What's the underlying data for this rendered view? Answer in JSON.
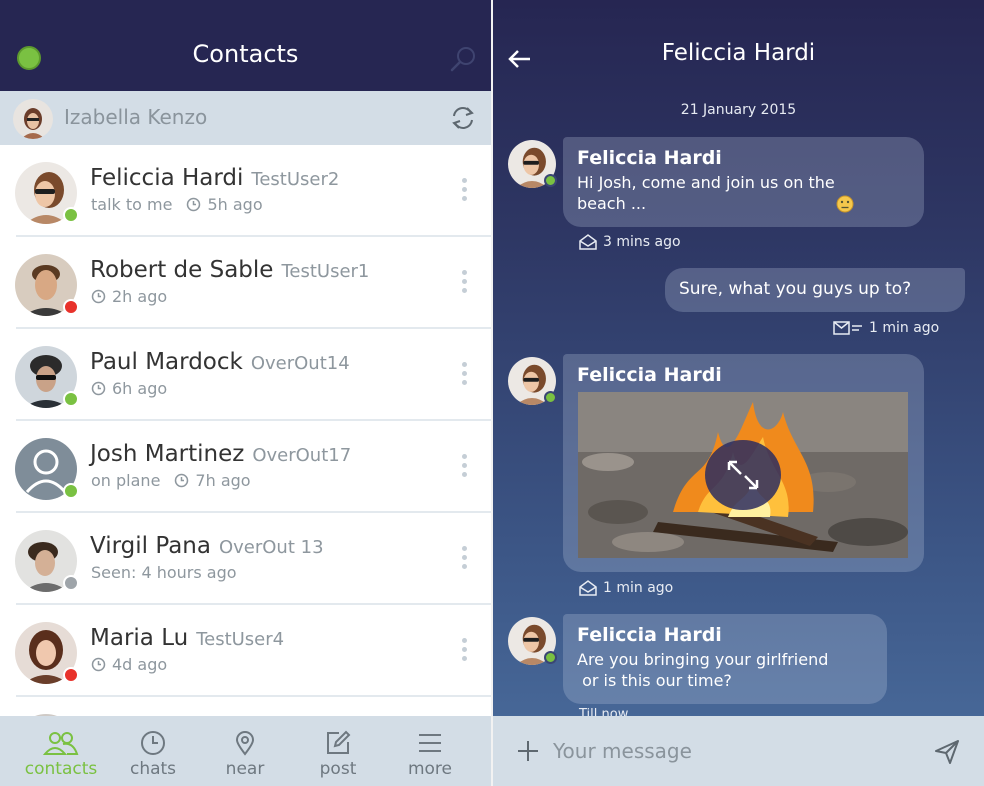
{
  "contacts_screen": {
    "title": "Contacts",
    "me": {
      "name": "Izabella Kenzo"
    },
    "contacts": [
      {
        "name": "Feliccia Hardi",
        "username": "TestUser2",
        "status": "talk to me",
        "time": "5h ago",
        "presence": "online"
      },
      {
        "name": "Robert de Sable",
        "username": "TestUser1",
        "status": "",
        "time": "2h ago",
        "presence": "busy"
      },
      {
        "name": "Paul Mardock",
        "username": "OverOut14",
        "status": "",
        "time": "6h ago",
        "presence": "online"
      },
      {
        "name": "Josh Martinez",
        "username": "OverOut17",
        "status": "on plane",
        "time": "7h ago",
        "presence": "online"
      },
      {
        "name": "Virgil Pana",
        "username": "OverOut 13",
        "status": "Seen: 4 hours ago",
        "time": "",
        "presence": "offline"
      },
      {
        "name": "Maria Lu",
        "username": "TestUser4",
        "status": "",
        "time": "4d ago",
        "presence": "busy"
      }
    ],
    "nav": [
      {
        "label": "contacts",
        "icon": "contacts-icon",
        "active": true
      },
      {
        "label": "chats",
        "icon": "clock-icon",
        "active": false
      },
      {
        "label": "near",
        "icon": "location-pin-icon",
        "active": false
      },
      {
        "label": "post",
        "icon": "edit-icon",
        "active": false
      },
      {
        "label": "more",
        "icon": "menu-icon",
        "active": false
      }
    ]
  },
  "chat_screen": {
    "title": "Feliccia Hardi",
    "date": "21 January 2015",
    "messages": [
      {
        "sender": "Feliccia Hardi",
        "text": "Hi Josh, come and join us on the\nbeach ...",
        "meta": "3 mins ago",
        "emoji": "neutral-face-emoji"
      },
      {
        "sender": "me",
        "text": "Sure, what you guys up to?",
        "meta": "1 min ago"
      },
      {
        "sender": "Feliccia Hardi",
        "image": "campfire-photo",
        "meta": "1 min ago"
      },
      {
        "sender": "Feliccia Hardi",
        "text": "Are you bringing your girlfriend\n or is this our time?",
        "meta": "Till now"
      }
    ],
    "compose_placeholder": "Your message"
  },
  "colors": {
    "header_bg": "#262652",
    "accent_green": "#7ac142",
    "status_red": "#e8322b",
    "status_gray": "#9ea4a9",
    "bar_bg": "#d3dde6"
  }
}
